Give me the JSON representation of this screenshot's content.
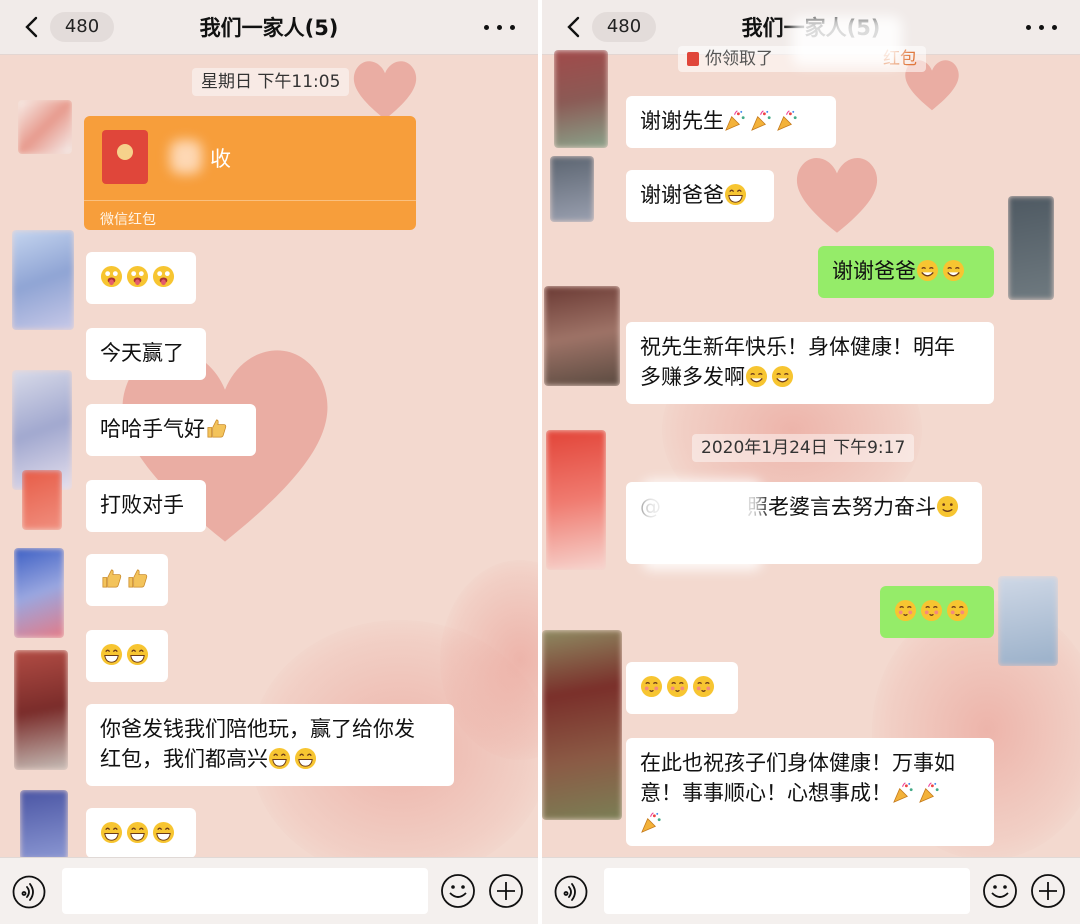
{
  "left": {
    "header": {
      "back_count": "480",
      "title": "我们一家人(5)"
    },
    "time_1": "星期日 下午11:05",
    "red_packet": {
      "text": "收",
      "footer": "微信红包"
    },
    "messages": [
      "今天赢了",
      "哈哈手气好",
      "打败对手",
      "你爸发钱我们陪他玩，赢了给你发",
      "红包，我们都高兴"
    ]
  },
  "right": {
    "header": {
      "back_count": "480",
      "title": "我们一家人(5)"
    },
    "top_notice": "你领取了",
    "top_notice_tail": "红包",
    "messages": [
      "谢谢先生",
      "谢谢爸爸",
      "谢谢爸爸",
      "祝先生新年快乐！身体健康！明年",
      "多赚多发啊",
      "照老婆言去努力奋斗",
      "在此也祝孩子们身体健康！万事如",
      "意！事事顺心！心想事成！"
    ],
    "time_2": "2020年1月24日 下午9:17",
    "mention_prefix": "@"
  },
  "emoji": {
    "tongue": "tongue-out-emoji",
    "thumbs": "thumbs-up-emoji",
    "grin": "grin-emoji",
    "party": "party-popper-emoji",
    "sweat": "sweat-smile-emoji",
    "smile": "smile-emoji",
    "angel": "blushing-face-emoji"
  },
  "colors": {
    "bubble_white": "#ffffff",
    "bubble_green": "#95ec69",
    "red_packet": "#f79e3b",
    "background": "#f3d9cf"
  }
}
